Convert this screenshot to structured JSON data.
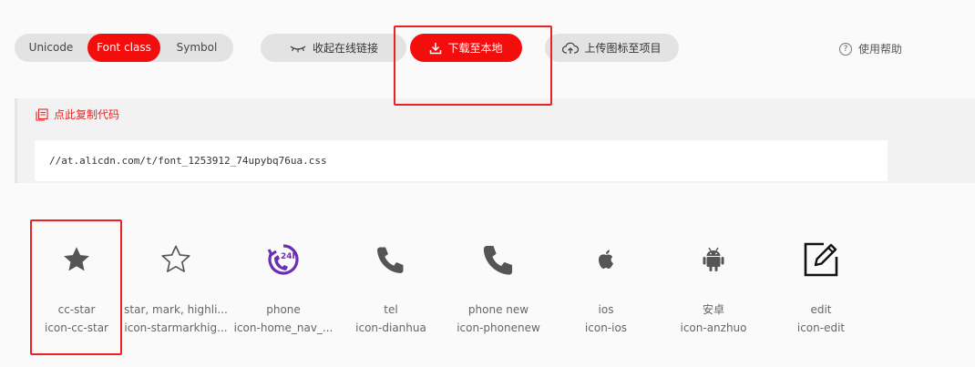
{
  "tabs": [
    {
      "label": "Unicode"
    },
    {
      "label": "Font class",
      "active": true
    },
    {
      "label": "Symbol"
    }
  ],
  "toolbar": {
    "collapse_label": "收起在线链接",
    "download_label": "下载至本地",
    "upload_label": "上传图标至项目",
    "help_label": "使用帮助",
    "help_glyph": "?"
  },
  "copy": {
    "link_label": "点此复制代码",
    "code": "//at.alicdn.com/t/font_1253912_74upybq76ua.css"
  },
  "icons": [
    {
      "name": "cc-star",
      "code": "icon-cc-star",
      "icon": "star-filled-icon"
    },
    {
      "name": "star, mark, highli...",
      "code": "icon-starmarkhig...",
      "icon": "star-outline-icon"
    },
    {
      "name": "phone",
      "code": "icon-home_nav_...",
      "icon": "phone-24h-icon",
      "badge": "24h"
    },
    {
      "name": "tel",
      "code": "icon-dianhua",
      "icon": "tel-icon"
    },
    {
      "name": "phone new",
      "code": "icon-phonenew",
      "icon": "phone-new-icon"
    },
    {
      "name": "ios",
      "code": "icon-ios",
      "icon": "apple-icon"
    },
    {
      "name": "安卓",
      "code": "icon-anzhuo",
      "icon": "android-icon"
    },
    {
      "name": "edit",
      "code": "icon-edit",
      "icon": "edit-icon"
    }
  ],
  "colors": {
    "accent": "#f40d0d",
    "highlight_box": "#e92323",
    "purple": "#6b2fb3"
  }
}
